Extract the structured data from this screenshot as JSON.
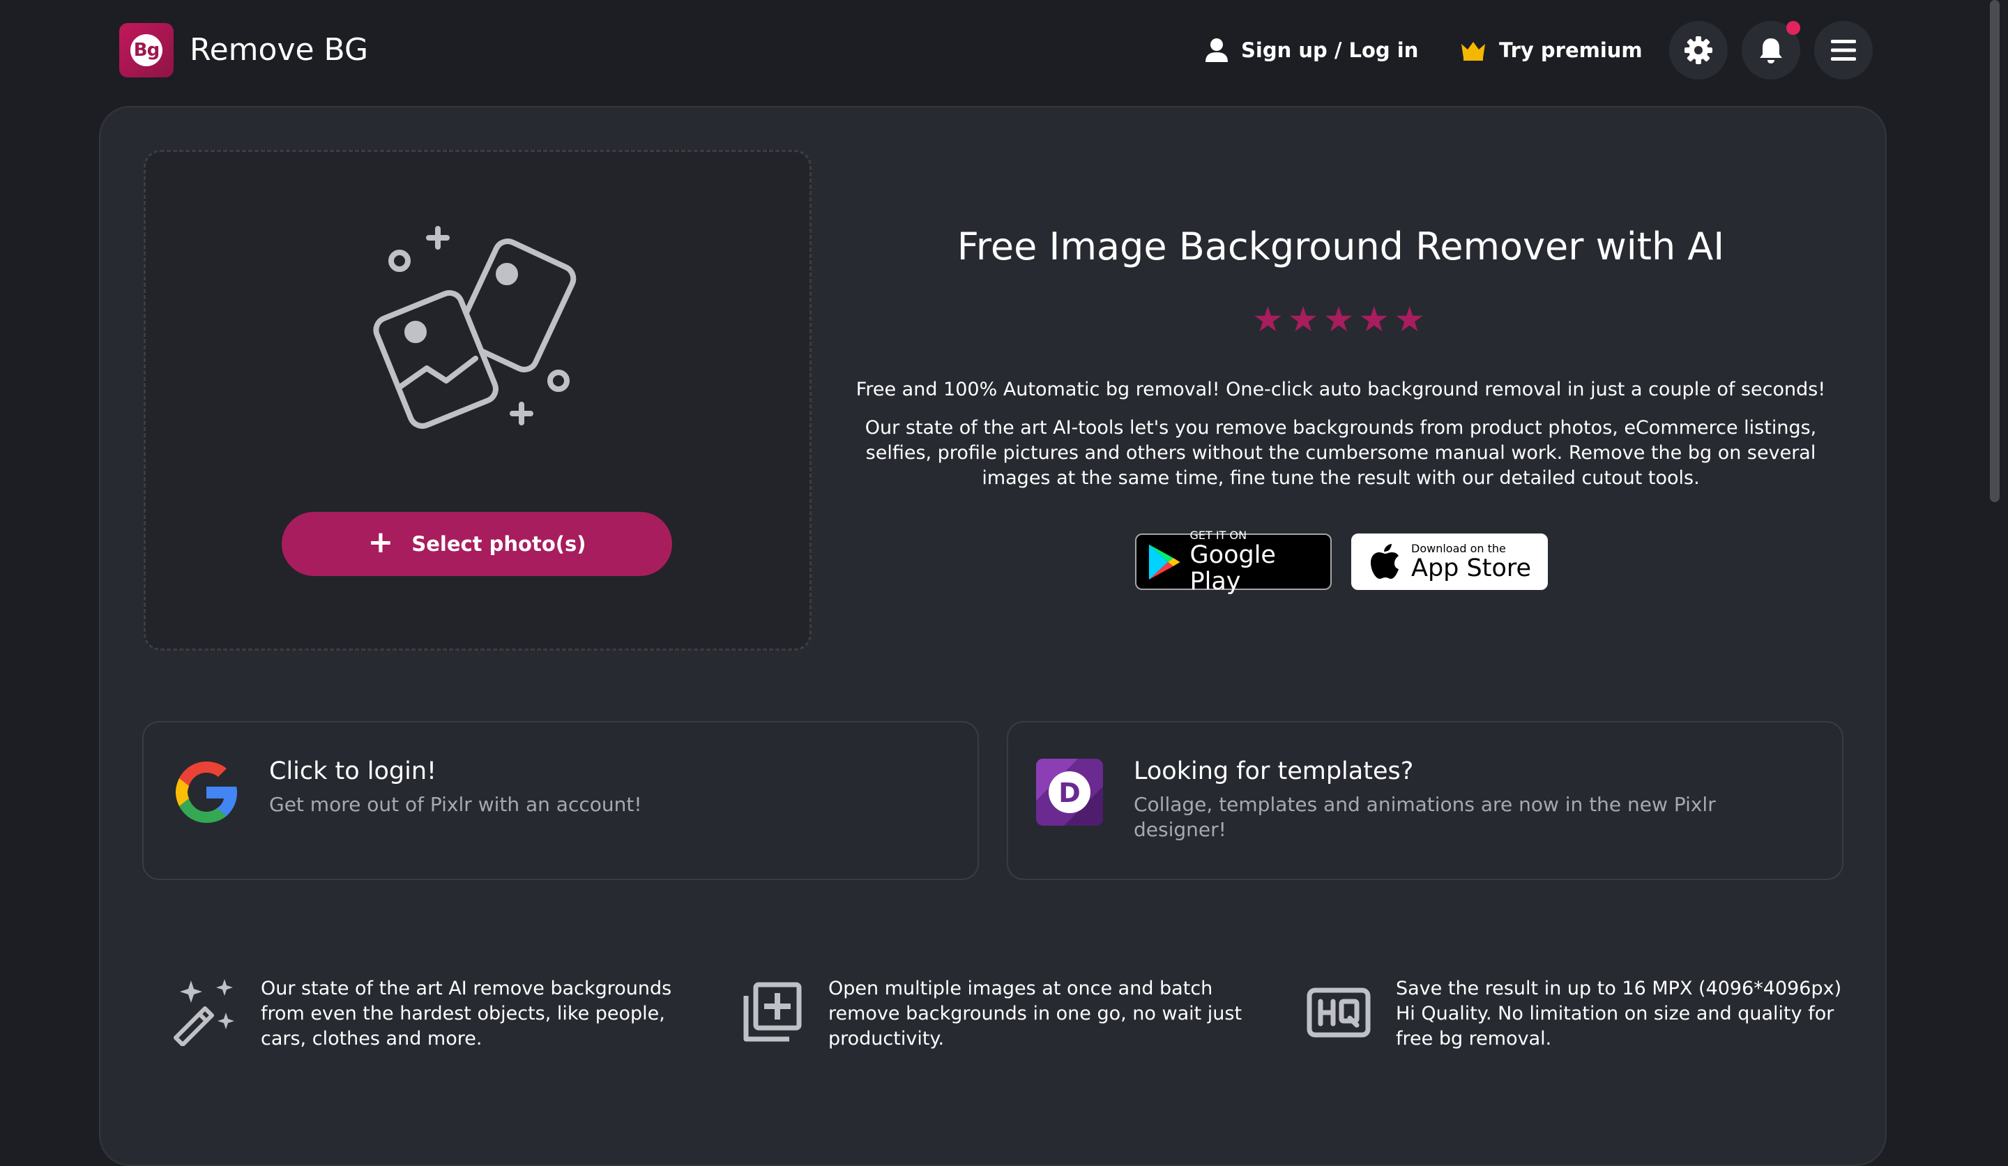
{
  "header": {
    "logo_text": "Bg",
    "app_title": "Remove BG",
    "login_label": "Sign up / Log in",
    "premium_label": "Try premium",
    "settings_icon": "gear-icon",
    "notifications_icon": "bell-icon",
    "menu_icon": "hamburger-menu-icon"
  },
  "upload": {
    "select_label": "Select photo(s)"
  },
  "hero": {
    "headline": "Free Image Background Remover with AI",
    "stars": "★★★★★",
    "tagline": "Free and 100% Automatic bg removal! One-click auto background removal in just a couple of seconds!",
    "description": "Our state of the art AI-tools let's you remove backgrounds from product photos, eCommerce listings, selfies, profile pictures and others without the cumbersome manual work. Remove the bg on several images at the same time, fine tune the result with our detailed cutout tools."
  },
  "stores": {
    "google_small": "GET IT ON",
    "google_big": "Google Play",
    "apple_small": "Download on the",
    "apple_big": "App Store"
  },
  "cards": {
    "login": {
      "title": "Click to login!",
      "subtitle": "Get more out of Pixlr with an account!"
    },
    "templates": {
      "title": "Looking for templates?",
      "subtitle": "Collage, templates and animations are now in the new Pixlr designer!",
      "icon_letter": "D"
    }
  },
  "features": [
    {
      "icon": "magic-wand-icon",
      "text": "Our state of the art AI remove backgrounds from even the hardest objects, like people, cars, clothes and more."
    },
    {
      "icon": "add-multiple-images-icon",
      "text": "Open multiple images at once and batch remove backgrounds in one go, no wait just productivity."
    },
    {
      "icon": "hq-icon",
      "text": "Save the result in up to 16 MPX (4096*4096px) Hi Quality. No limitation on size and quality for free bg removal."
    }
  ],
  "colors": {
    "accent": "#a81d5d",
    "background": "#1c1e23",
    "panel": "#272a31"
  }
}
